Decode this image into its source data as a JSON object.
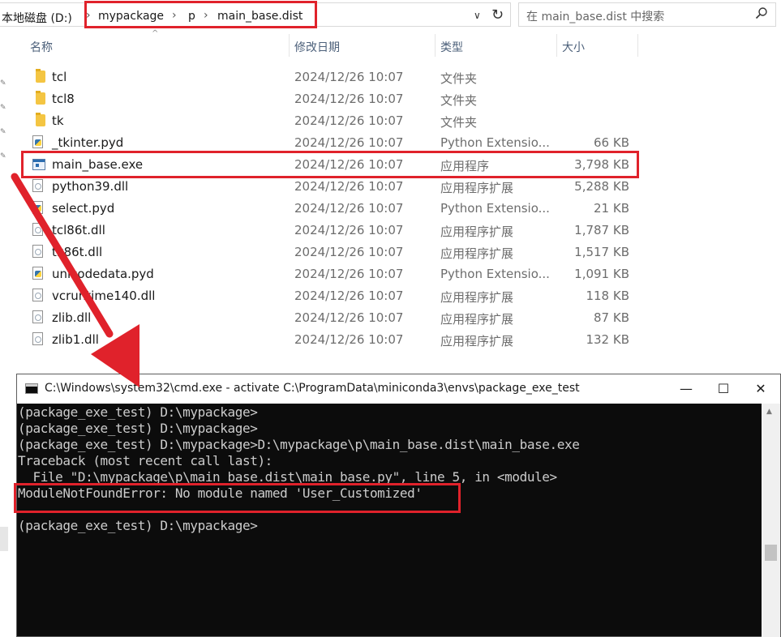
{
  "explorer": {
    "breadcrumb": {
      "drive": "本地磁盘 (D:)",
      "parts": [
        "mypackage",
        "p",
        "main_base.dist"
      ]
    },
    "search_placeholder": "在 main_base.dist 中搜索",
    "columns": {
      "name": "名称",
      "date": "修改日期",
      "type": "类型",
      "size": "大小"
    },
    "files": [
      {
        "name": "tcl",
        "date": "2024/12/26 10:07",
        "type": "文件夹",
        "size": "",
        "icon": "folder-icon"
      },
      {
        "name": "tcl8",
        "date": "2024/12/26 10:07",
        "type": "文件夹",
        "size": "",
        "icon": "folder-icon"
      },
      {
        "name": "tk",
        "date": "2024/12/26 10:07",
        "type": "文件夹",
        "size": "",
        "icon": "folder-icon"
      },
      {
        "name": "_tkinter.pyd",
        "date": "2024/12/26 10:07",
        "type": "Python Extensio...",
        "size": "66 KB",
        "icon": "python-file-icon"
      },
      {
        "name": "main_base.exe",
        "date": "2024/12/26 10:07",
        "type": "应用程序",
        "size": "3,798 KB",
        "icon": "exe-icon"
      },
      {
        "name": "python39.dll",
        "date": "2024/12/26 10:07",
        "type": "应用程序扩展",
        "size": "5,288 KB",
        "icon": "dll-icon"
      },
      {
        "name": "select.pyd",
        "date": "2024/12/26 10:07",
        "type": "Python Extensio...",
        "size": "21 KB",
        "icon": "python-file-icon"
      },
      {
        "name": "tcl86t.dll",
        "date": "2024/12/26 10:07",
        "type": "应用程序扩展",
        "size": "1,787 KB",
        "icon": "dll-icon"
      },
      {
        "name": "tk86t.dll",
        "date": "2024/12/26 10:07",
        "type": "应用程序扩展",
        "size": "1,517 KB",
        "icon": "dll-icon"
      },
      {
        "name": "unicodedata.pyd",
        "date": "2024/12/26 10:07",
        "type": "Python Extensio...",
        "size": "1,091 KB",
        "icon": "python-file-icon"
      },
      {
        "name": "vcruntime140.dll",
        "date": "2024/12/26 10:07",
        "type": "应用程序扩展",
        "size": "118 KB",
        "icon": "dll-icon"
      },
      {
        "name": "zlib.dll",
        "date": "2024/12/26 10:07",
        "type": "应用程序扩展",
        "size": "87 KB",
        "icon": "dll-icon"
      },
      {
        "name": "zlib1.dll",
        "date": "2024/12/26 10:07",
        "type": "应用程序扩展",
        "size": "132 KB",
        "icon": "dll-icon"
      }
    ]
  },
  "cmd": {
    "title": "C:\\Windows\\system32\\cmd.exe - activate  C:\\ProgramData\\miniconda3\\envs\\package_exe_test",
    "buttons": {
      "minimize": "—",
      "maximize": "☐",
      "close": "✕"
    },
    "lines": [
      "(package_exe_test) D:\\mypackage>",
      "(package_exe_test) D:\\mypackage>",
      "(package_exe_test) D:\\mypackage>D:\\mypackage\\p\\main_base.dist\\main_base.exe",
      "Traceback (most recent call last):",
      "  File \"D:\\mypackage\\p\\main_base.dist\\main_base.py\", line 5, in <module>",
      "ModuleNotFoundError: No module named 'User_Customized'",
      "",
      "(package_exe_test) D:\\mypackage>"
    ]
  },
  "colors": {
    "highlight": "#e0222b",
    "console_bg": "#0c0c0c",
    "console_text": "#cccccc"
  }
}
